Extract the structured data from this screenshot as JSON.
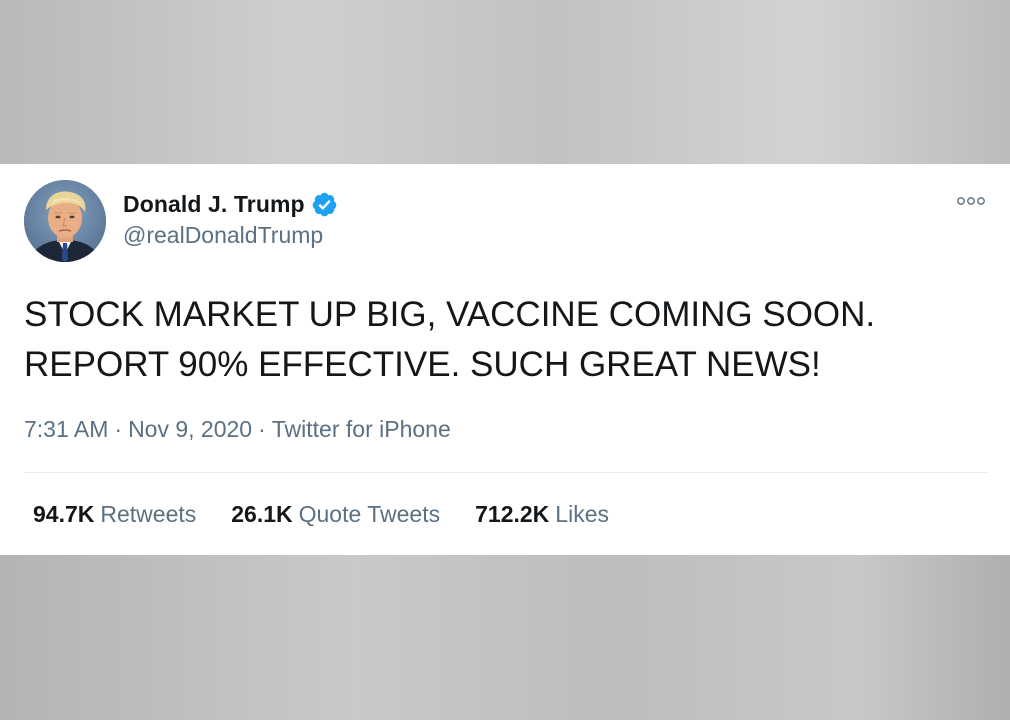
{
  "tweet": {
    "author": {
      "display_name": "Donald J. Trump",
      "handle": "@realDonaldTrump",
      "verified": true
    },
    "text_lines": [
      "STOCK MARKET UP BIG, VACCINE COMING SOON.",
      "REPORT 90% EFFECTIVE. SUCH GREAT NEWS!"
    ],
    "meta": {
      "time": "7:31 AM",
      "separator": "·",
      "date": "Nov 9, 2020",
      "source": "Twitter for iPhone"
    },
    "stats": {
      "retweets": {
        "count": "94.7K",
        "label": "Retweets"
      },
      "quote_tweets": {
        "count": "26.1K",
        "label": "Quote Tweets"
      },
      "likes": {
        "count": "712.2K",
        "label": "Likes"
      }
    }
  },
  "icons": {
    "verified": "verified-badge-icon",
    "more": "more-options-icon"
  },
  "colors": {
    "verified_blue": "#1da1f2",
    "text_primary": "#14171a",
    "text_secondary": "#5b7083",
    "divider": "#e6ecf0",
    "card_background": "#ffffff"
  }
}
